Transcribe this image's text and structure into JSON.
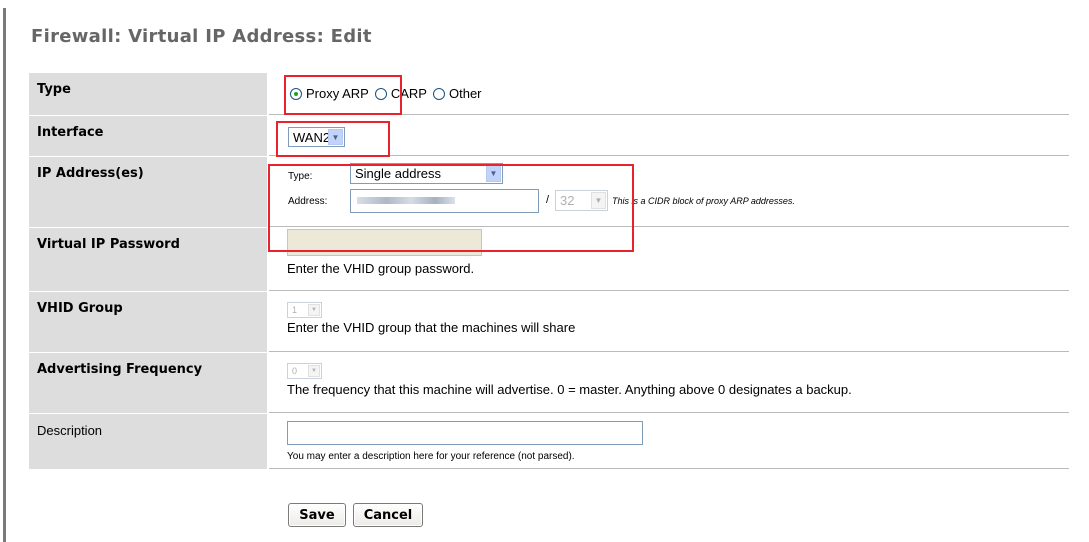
{
  "page": {
    "title": "Firewall: Virtual IP Address: Edit"
  },
  "type_row": {
    "label": "Type",
    "options": [
      {
        "label": "Proxy ARP",
        "selected": true
      },
      {
        "label": "CARP",
        "selected": false
      },
      {
        "label": "Other",
        "selected": false
      }
    ]
  },
  "interface_row": {
    "label": "Interface",
    "selected": "WAN2"
  },
  "ip_row": {
    "label": "IP Address(es)",
    "type_label": "Type:",
    "type_selected": "Single address",
    "address_label": "Address:",
    "address_value": "",
    "slash": "/",
    "cidr_value": "32",
    "cidr_note": "This is a CIDR block of proxy ARP addresses."
  },
  "password_row": {
    "label": "Virtual IP Password",
    "hint": "Enter the VHID group password."
  },
  "vhid_row": {
    "label": "VHID Group",
    "selected": "1",
    "hint": "Enter the VHID group that the machines will share"
  },
  "adv_row": {
    "label": "Advertising Frequency",
    "selected": "0",
    "hint": "The frequency that this machine will advertise. 0 = master. Anything above 0 designates a backup."
  },
  "desc_row": {
    "label": "Description",
    "value": "",
    "hint": "You may enter a description here for your reference (not parsed)."
  },
  "buttons": {
    "save": "Save",
    "cancel": "Cancel"
  },
  "colors": {
    "label_bg": "#dddddd",
    "highlight": "#e8232e",
    "title": "#666666"
  },
  "icons": {
    "dropdown": "chevron-down-icon",
    "radio": "radio-icon"
  }
}
